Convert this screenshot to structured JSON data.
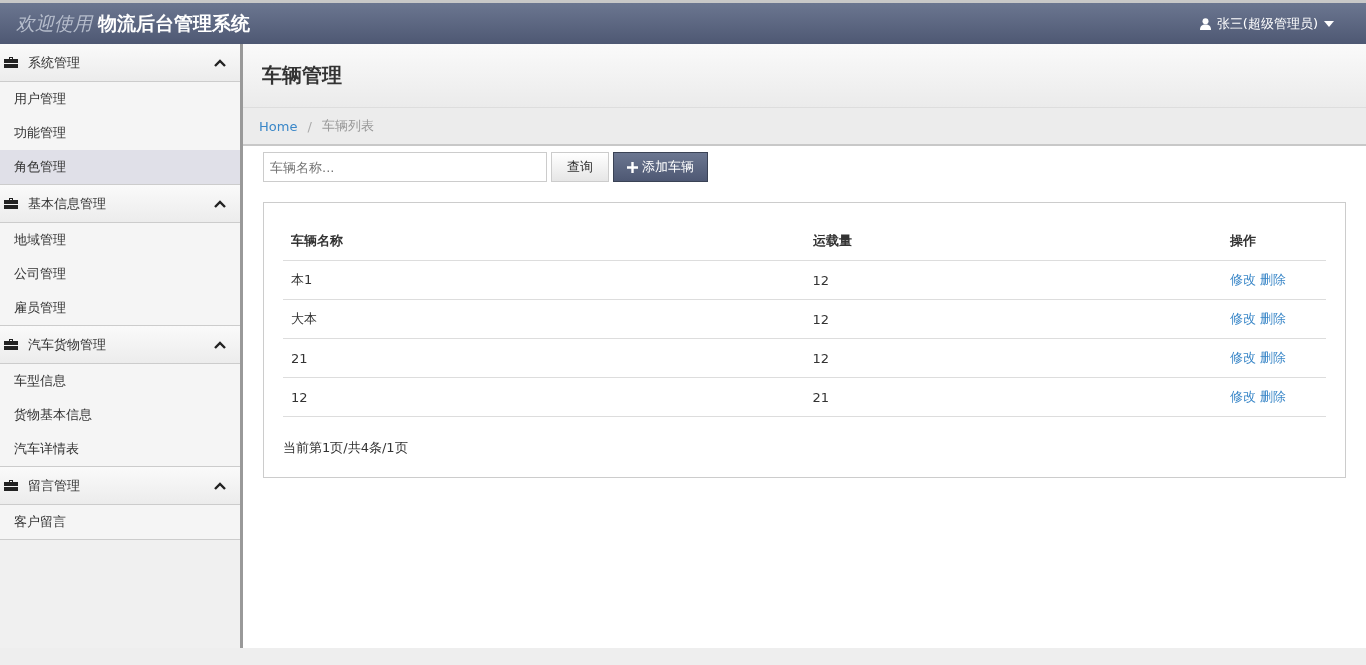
{
  "header": {
    "welcome": "欢迎使用",
    "title": "物流后台管理系统",
    "user": "张三(超级管理员)"
  },
  "sidebar": [
    {
      "title": "系统管理",
      "expanded": true,
      "items": [
        {
          "label": "用户管理",
          "selected": false
        },
        {
          "label": "功能管理",
          "selected": false
        },
        {
          "label": "角色管理",
          "selected": true
        }
      ]
    },
    {
      "title": "基本信息管理",
      "expanded": true,
      "items": [
        {
          "label": "地域管理",
          "selected": false
        },
        {
          "label": "公司管理",
          "selected": false
        },
        {
          "label": "雇员管理",
          "selected": false
        }
      ]
    },
    {
      "title": "汽车货物管理",
      "expanded": true,
      "items": [
        {
          "label": "车型信息",
          "selected": false
        },
        {
          "label": "货物基本信息",
          "selected": false
        },
        {
          "label": "汽车详情表",
          "selected": false
        }
      ]
    },
    {
      "title": "留言管理",
      "expanded": true,
      "items": [
        {
          "label": "客户留言",
          "selected": false
        }
      ]
    }
  ],
  "page_title": "车辆管理",
  "breadcrumb": {
    "home": "Home",
    "separator": "/",
    "current": "车辆列表"
  },
  "search": {
    "placeholder": "车辆名称...",
    "query_button": "查询",
    "add_button": "添加车辆"
  },
  "table": {
    "columns": [
      "车辆名称",
      "运载量",
      "操作"
    ],
    "rows": [
      {
        "name": "本1",
        "capacity": "12",
        "actions": [
          "修改",
          "删除"
        ]
      },
      {
        "name": "大本",
        "capacity": "12",
        "actions": [
          "修改",
          "删除"
        ]
      },
      {
        "name": "21",
        "capacity": "12",
        "actions": [
          "修改",
          "删除"
        ]
      },
      {
        "name": "12",
        "capacity": "21",
        "actions": [
          "修改",
          "删除"
        ]
      }
    ]
  },
  "pagination": "当前第1页/共4条/1页"
}
